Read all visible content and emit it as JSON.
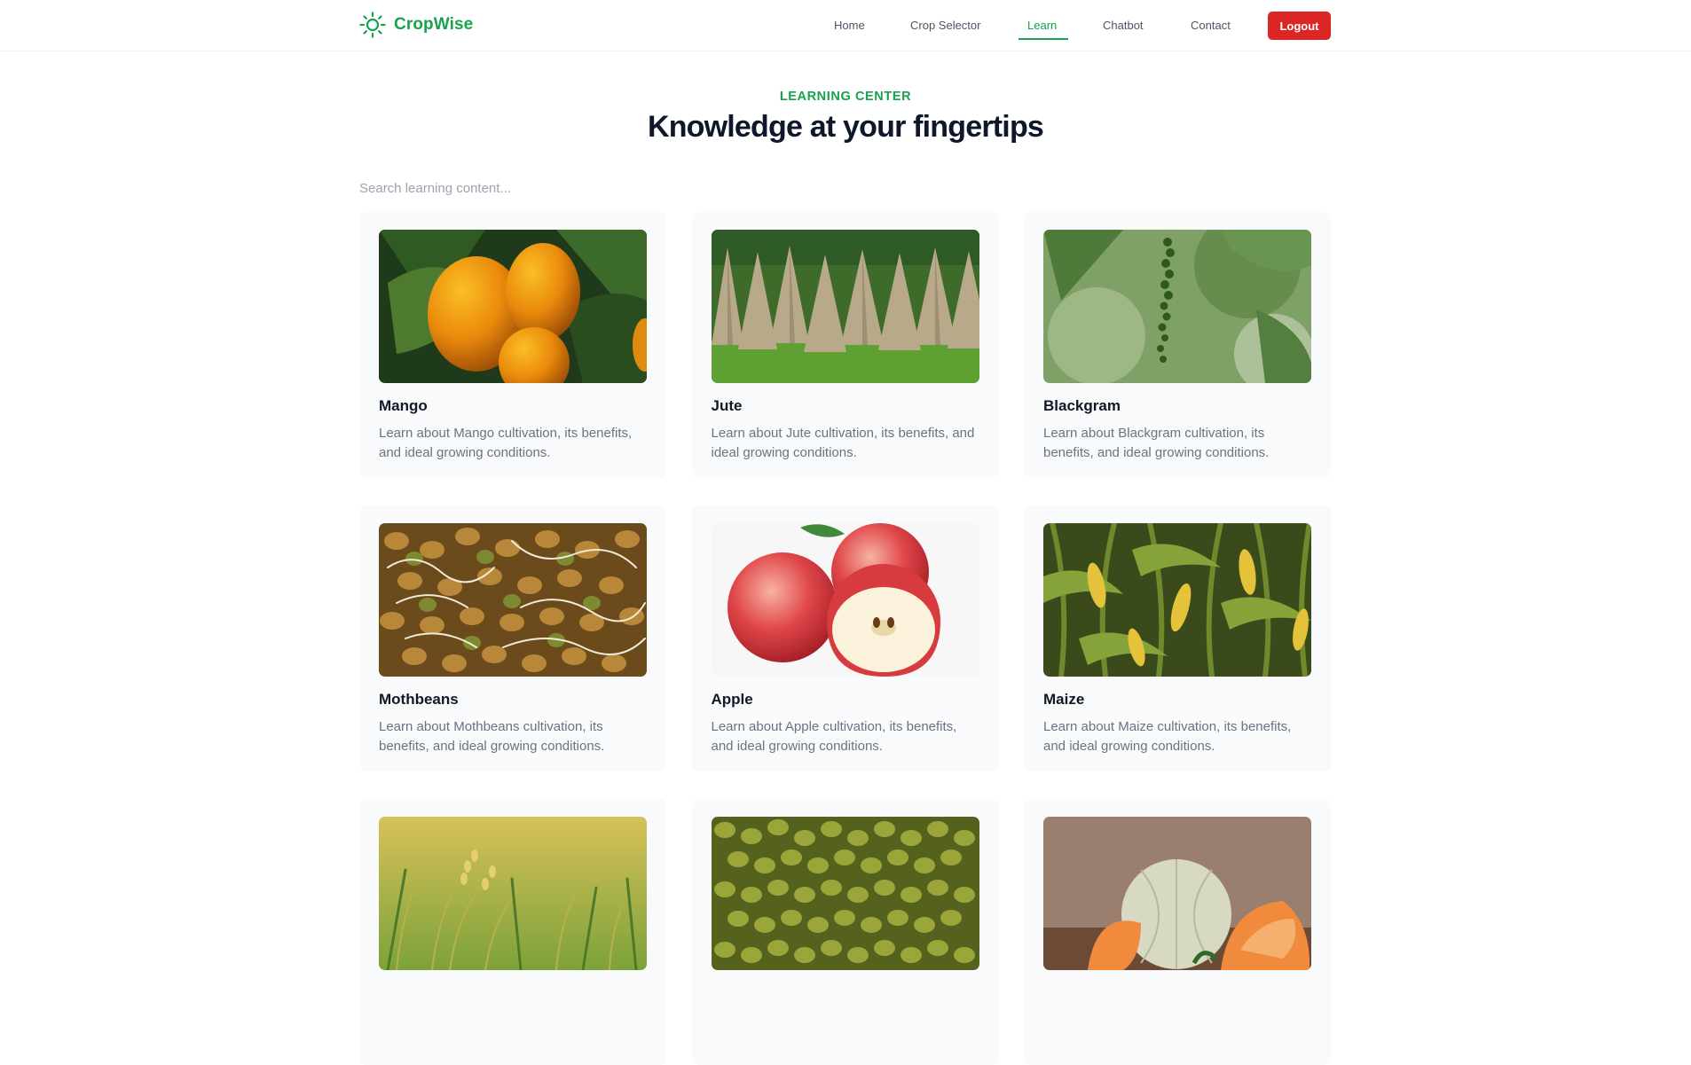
{
  "brand": {
    "name": "CropWise",
    "icon": "sun-icon",
    "color": "#16a34a"
  },
  "nav": {
    "items": [
      {
        "label": "Home",
        "active": false
      },
      {
        "label": "Crop Selector",
        "active": false
      },
      {
        "label": "Learn",
        "active": true
      },
      {
        "label": "Chatbot",
        "active": false
      },
      {
        "label": "Contact",
        "active": false
      }
    ],
    "logout_label": "Logout",
    "logout_color": "#dc2626"
  },
  "hero": {
    "eyebrow": "LEARNING CENTER",
    "title": "Knowledge at your fingertips"
  },
  "search": {
    "placeholder": "Search learning content...",
    "value": ""
  },
  "cards": [
    {
      "title": "Mango",
      "description": "Learn about Mango cultivation, its benefits, and ideal growing conditions."
    },
    {
      "title": "Jute",
      "description": "Learn about Jute cultivation, its benefits, and ideal growing conditions."
    },
    {
      "title": "Blackgram",
      "description": "Learn about Blackgram cultivation, its benefits, and ideal growing conditions."
    },
    {
      "title": "Mothbeans",
      "description": "Learn about Mothbeans cultivation, its benefits, and ideal growing conditions."
    },
    {
      "title": "Apple",
      "description": "Learn about Apple cultivation, its benefits, and ideal growing conditions."
    },
    {
      "title": "Maize",
      "description": "Learn about Maize cultivation, its benefits, and ideal growing conditions."
    },
    {
      "title": "",
      "description": ""
    },
    {
      "title": "",
      "description": ""
    },
    {
      "title": "",
      "description": ""
    }
  ]
}
